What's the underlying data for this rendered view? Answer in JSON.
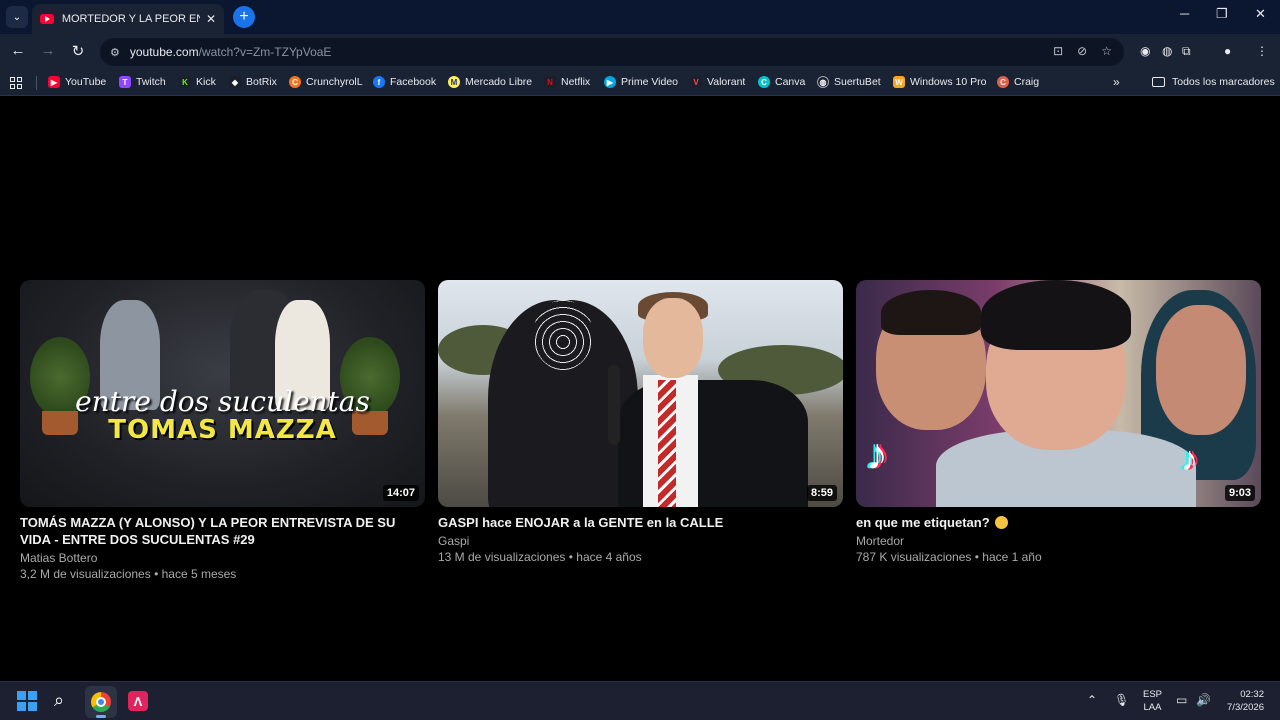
{
  "browser": {
    "tab_title": "MORTEDOR Y LA PEOR ENTREV",
    "url_host": "youtube.com",
    "url_path": "/watch?v=Zm-TZYpVoaE"
  },
  "bookmarks": {
    "items": [
      {
        "label": "YouTube",
        "color": "#ff0033",
        "glyph": "▶"
      },
      {
        "label": "Twitch",
        "color": "#9146ff",
        "glyph": "T"
      },
      {
        "label": "Kick",
        "color": "#53fc18",
        "glyph": "K"
      },
      {
        "label": "BotRix",
        "color": "#ffffff",
        "glyph": "◆"
      },
      {
        "label": "CrunchyrolL",
        "color": "#f47521",
        "glyph": "C"
      },
      {
        "label": "Facebook",
        "color": "#1877f2",
        "glyph": "f"
      },
      {
        "label": "Mercado Libre",
        "color": "#fff159",
        "glyph": "M"
      },
      {
        "label": "Netflix",
        "color": "#e50914",
        "glyph": "N"
      },
      {
        "label": "Prime Video",
        "color": "#00a8e1",
        "glyph": "▶"
      },
      {
        "label": "Valorant",
        "color": "#ff4655",
        "glyph": "V"
      },
      {
        "label": "Canva",
        "color": "#00c4cc",
        "glyph": "C"
      },
      {
        "label": "SuertuBet",
        "color": "#3b82f6",
        "glyph": "S"
      },
      {
        "label": "Windows 10 Pro",
        "color": "#f5a623",
        "glyph": "W"
      },
      {
        "label": "Craig",
        "color": "#e0604a",
        "glyph": "C"
      }
    ],
    "all_bookmarks": "Todos los marcadores"
  },
  "videos": [
    {
      "title": "TOMÁS MAZZA (Y ALONSO) Y LA PEOR ENTREVISTA DE SU VIDA - ENTRE DOS SUCULENTAS #29",
      "channel": "Matias Bottero",
      "stats": "3,2 M de visualizaciones • hace 5 meses",
      "duration": "14:07",
      "thumb_text_1": "entre dos suculentas",
      "thumb_text_2": "TOMAS MAZZA"
    },
    {
      "title": "GASPI hace ENOJAR a la GENTE en la CALLE",
      "channel": "Gaspi",
      "stats": "13 M de visualizaciones • hace 4 años",
      "duration": "8:59"
    },
    {
      "title": "en que me etiquetan? ",
      "channel": "Mortedor",
      "stats": "787 K visualizaciones • hace 1 año",
      "duration": "9:03"
    }
  ],
  "taskbar": {
    "lang_1": "ESP",
    "lang_2": "LAA",
    "time": "02:32",
    "date": "7/3/2026"
  }
}
